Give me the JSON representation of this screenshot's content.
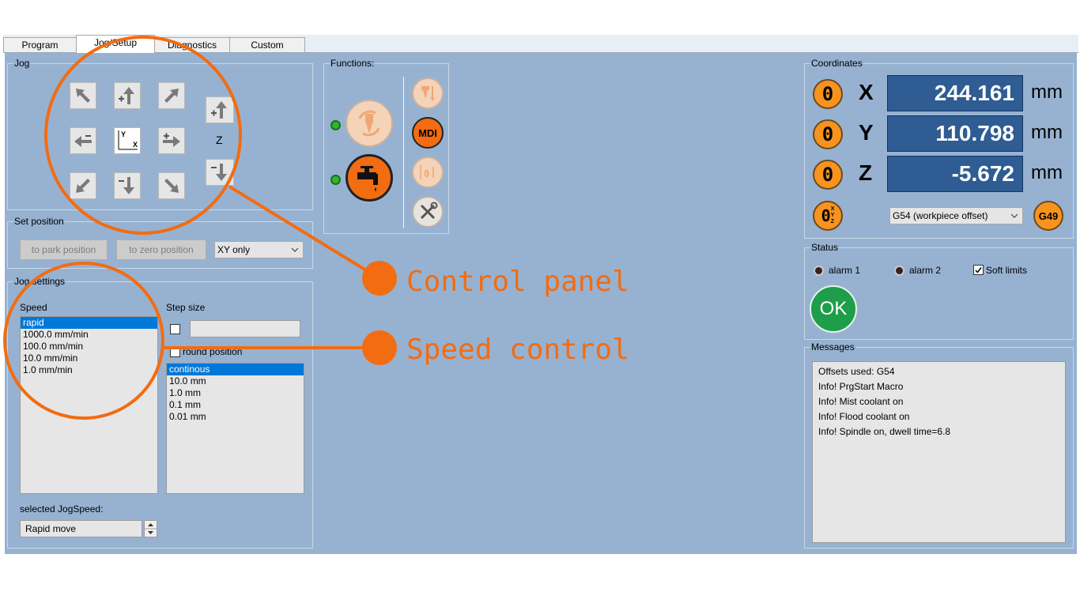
{
  "tabs": [
    "Program",
    "Jog/Setup",
    "Diagnostics",
    "Custom"
  ],
  "jog": {
    "title": "Jog",
    "z_label": "Z",
    "axis_y": "Y",
    "axis_x": "X"
  },
  "set_position": {
    "title": "Set position",
    "park_button": "to park position",
    "zero_button": "to zero position",
    "mode_select": "XY only"
  },
  "jog_settings": {
    "title": "Jog settings",
    "speed_label": "Speed",
    "speed_options": [
      "rapid",
      "1000.0 mm/min",
      "100.0 mm/min",
      "10.0 mm/min",
      "1.0 mm/min"
    ],
    "speed_selected_index": 0,
    "step_label": "Step size",
    "step_input": "",
    "round_position_label": "round position",
    "step_options": [
      "continous",
      "10.0 mm",
      "1.0 mm",
      "0.1 mm",
      "0.01 mm"
    ],
    "step_selected_index": 0,
    "selected_speed_label": "selected JogSpeed:",
    "selected_speed_value": "Rapid move"
  },
  "functions": {
    "title": "Functions:",
    "mdi_label": "MDI",
    "spindle_led": "on",
    "coolant_led": "on"
  },
  "coordinates": {
    "title": "Coordinates",
    "axes": [
      {
        "name": "X",
        "value": "244.161",
        "unit": "mm"
      },
      {
        "name": "Y",
        "value": "110.798",
        "unit": "mm"
      },
      {
        "name": "Z",
        "value": "-5.672",
        "unit": "mm"
      }
    ],
    "zero_label": "0",
    "zero_all_sub": [
      "X",
      "Y",
      "Z"
    ],
    "offset_select": "G54 (workpiece offset)",
    "g49_label": "G49"
  },
  "status": {
    "title": "Status",
    "alarm1": "alarm 1",
    "alarm2": "alarm 2",
    "soft_limits": "Soft limits",
    "soft_limits_checked": true,
    "ok_label": "OK"
  },
  "messages": {
    "title": "Messages",
    "lines": [
      "Offsets used: G54",
      "Info! PrgStart Macro",
      "Info! Mist coolant on",
      "Info! Flood coolant on",
      "Info! Spindle on, dwell time=6.8"
    ]
  },
  "annotations": {
    "control_panel": "Control panel",
    "speed_control": "Speed control"
  },
  "colors": {
    "accent": "#f26c12",
    "panel_bg": "#97b2d1",
    "coord_bg": "#2e5c93",
    "ok_green": "#1e9e4a",
    "zero_orange": "#f7931e"
  }
}
